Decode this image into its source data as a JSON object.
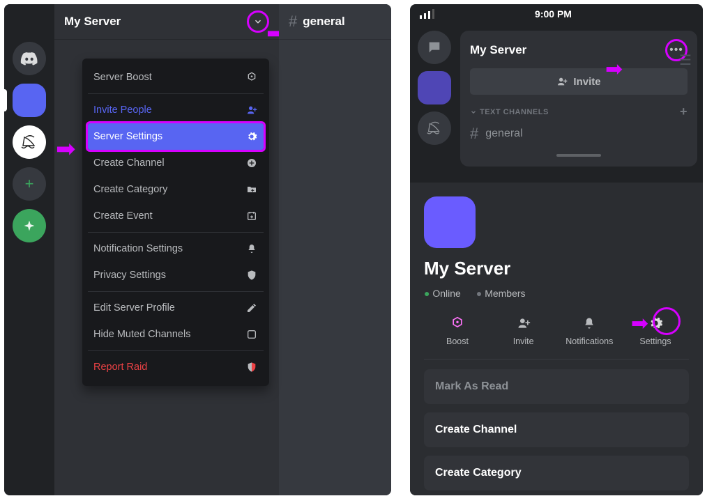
{
  "desktop": {
    "server_name": "My Server",
    "channel_header": {
      "hash": "#",
      "name": "general"
    },
    "dropdown": {
      "boost": "Server Boost",
      "invite": "Invite People",
      "settings": "Server Settings",
      "create_channel": "Create Channel",
      "create_category": "Create Category",
      "create_event": "Create Event",
      "notification": "Notification Settings",
      "privacy": "Privacy Settings",
      "edit_profile": "Edit Server Profile",
      "hide_muted": "Hide Muted Channels",
      "report": "Report Raid"
    }
  },
  "mobile": {
    "status_time": "9:00 PM",
    "server_name": "My Server",
    "invite_label": "Invite",
    "section_text_channels": "TEXT CHANNELS",
    "channel_general": "general",
    "sheet": {
      "title": "My Server",
      "online": "Online",
      "members": "Members",
      "icons": {
        "boost": "Boost",
        "invite": "Invite",
        "notifications": "Notifications",
        "settings": "Settings"
      },
      "rows": {
        "mark_read": "Mark As Read",
        "create_channel": "Create Channel",
        "create_category": "Create Category"
      }
    }
  }
}
